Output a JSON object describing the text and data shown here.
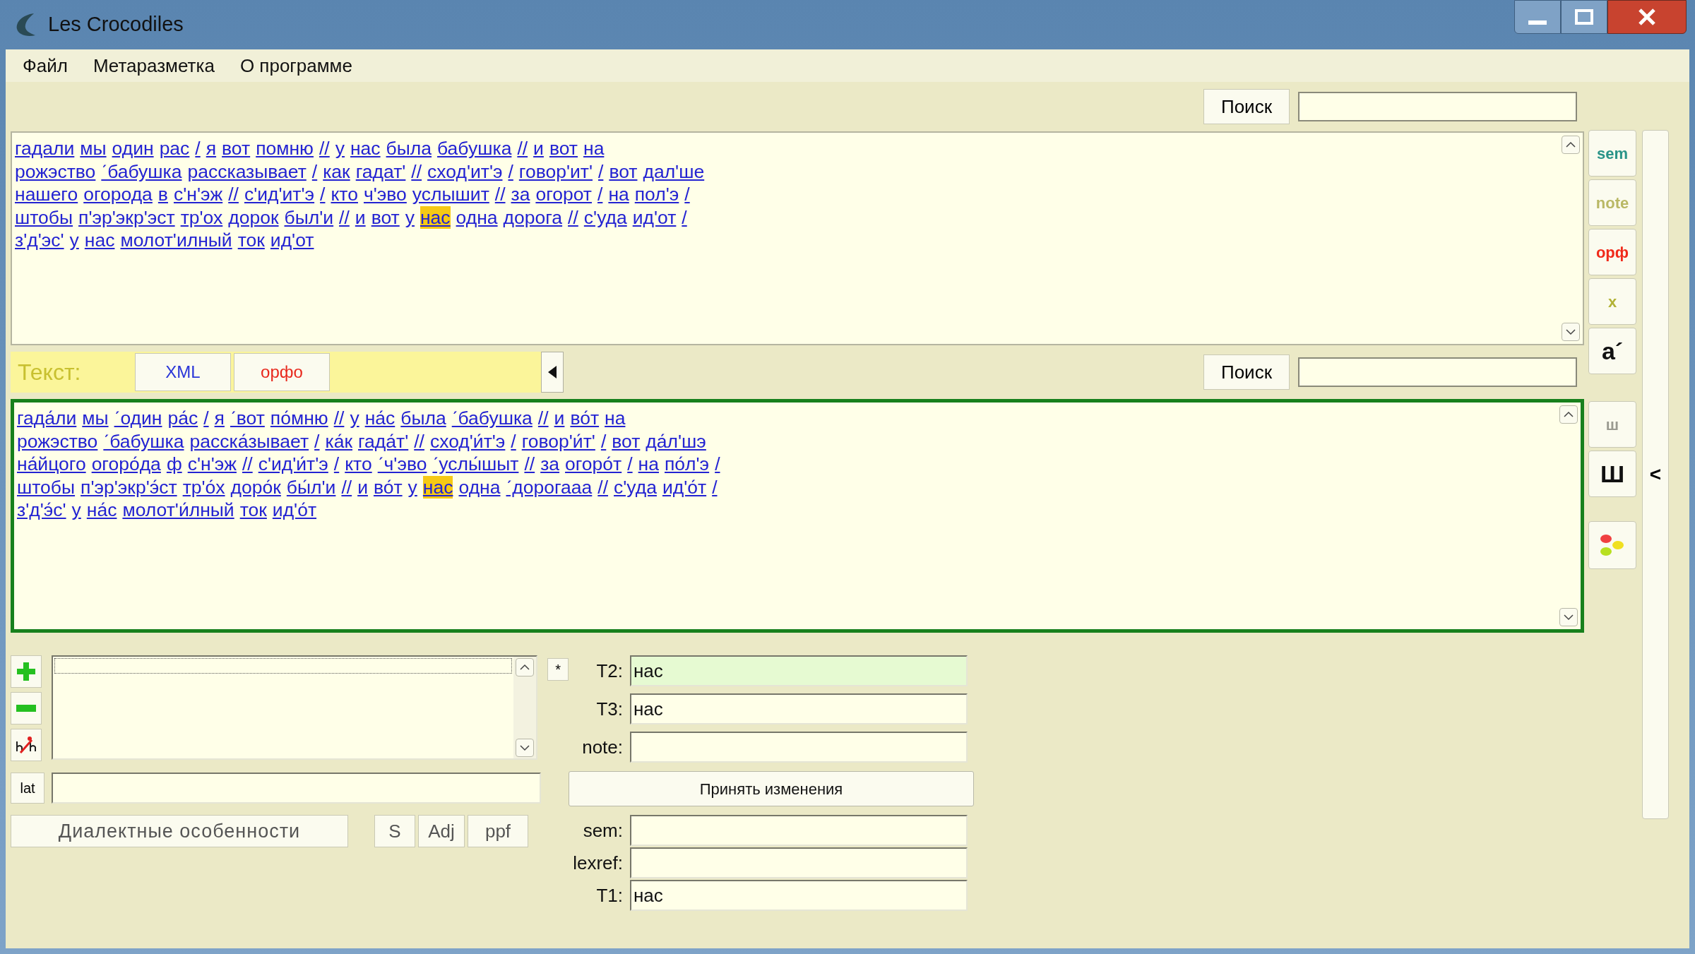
{
  "window": {
    "title": "Les Crocodiles"
  },
  "menu": [
    "Файл",
    "Метаразметка",
    "О программе"
  ],
  "top_search": {
    "button": "Поиск"
  },
  "top_text": {
    "lines": [
      [
        {
          "w": "гадали",
          "selected": false
        },
        {
          "w": "мы",
          "selected": false
        },
        {
          "w": "один",
          "selected": false
        },
        {
          "w": "рас",
          "selected": false
        },
        {
          "w": "/",
          "selected": false
        },
        {
          "w": "я",
          "selected": false
        },
        {
          "w": "вот",
          "selected": false
        },
        {
          "w": "помню",
          "selected": false
        },
        {
          "w": "//",
          "selected": false
        },
        {
          "w": "у",
          "selected": false
        },
        {
          "w": "нас",
          "selected": false
        },
        {
          "w": "была",
          "selected": false
        },
        {
          "w": "бабушка",
          "selected": false
        },
        {
          "w": "//",
          "selected": false
        },
        {
          "w": "и",
          "selected": false
        },
        {
          "w": "вот",
          "selected": false
        },
        {
          "w": "на",
          "selected": false
        }
      ],
      [
        {
          "w": "рожэство",
          "selected": false
        },
        {
          "w": "ˊбабушка",
          "selected": false
        },
        {
          "w": "рассказывает",
          "selected": false
        },
        {
          "w": "/",
          "selected": false
        },
        {
          "w": "как",
          "selected": false
        },
        {
          "w": "гадат'",
          "selected": false
        },
        {
          "w": "//",
          "selected": false
        },
        {
          "w": "сход'ит'э",
          "selected": false
        },
        {
          "w": "/",
          "selected": false
        },
        {
          "w": "говор'ит'",
          "selected": false
        },
        {
          "w": "/",
          "selected": false
        },
        {
          "w": "вот",
          "selected": false
        },
        {
          "w": "дал'ше",
          "selected": false
        }
      ],
      [
        {
          "w": "нашего",
          "selected": false
        },
        {
          "w": "огорода",
          "selected": false
        },
        {
          "w": "в",
          "selected": false
        },
        {
          "w": "с'н'эж",
          "selected": false
        },
        {
          "w": "//",
          "selected": false
        },
        {
          "w": "с'ид'ит'э",
          "selected": false
        },
        {
          "w": "/",
          "selected": false
        },
        {
          "w": "кто",
          "selected": false
        },
        {
          "w": "ч'эво",
          "selected": false
        },
        {
          "w": "услышит",
          "selected": false
        },
        {
          "w": "//",
          "selected": false
        },
        {
          "w": "за",
          "selected": false
        },
        {
          "w": "огорот",
          "selected": false
        },
        {
          "w": "/",
          "selected": false
        },
        {
          "w": "на",
          "selected": false
        },
        {
          "w": "пол'э",
          "selected": false
        },
        {
          "w": "/",
          "selected": false
        }
      ],
      [
        {
          "w": "штобы",
          "selected": false
        },
        {
          "w": "п'эр'экр'эст",
          "selected": false
        },
        {
          "w": "тр'ох",
          "selected": false
        },
        {
          "w": "дорок",
          "selected": false
        },
        {
          "w": "был'и",
          "selected": false
        },
        {
          "w": "//",
          "selected": false
        },
        {
          "w": "и",
          "selected": false
        },
        {
          "w": "вот",
          "selected": false
        },
        {
          "w": "у",
          "selected": false
        },
        {
          "w": "нас",
          "selected": true
        },
        {
          "w": "одна",
          "selected": false
        },
        {
          "w": "дорога",
          "selected": false
        },
        {
          "w": "//",
          "selected": false
        },
        {
          "w": "с'уда",
          "selected": false
        },
        {
          "w": "ид'от",
          "selected": false
        },
        {
          "w": "/",
          "selected": false
        }
      ],
      [
        {
          "w": "з'д'эс'",
          "selected": false
        },
        {
          "w": "у",
          "selected": false
        },
        {
          "w": "нас",
          "selected": false
        },
        {
          "w": "молот'илный",
          "selected": false
        },
        {
          "w": "ток",
          "selected": false
        },
        {
          "w": "ид'от",
          "selected": false
        }
      ]
    ]
  },
  "side_buttons": [
    {
      "kind": "text",
      "label": "sem",
      "color": "#2a9488"
    },
    {
      "kind": "text",
      "label": "note",
      "color": "#b9b865"
    },
    {
      "kind": "text",
      "label": "орф",
      "color": "#f02a1a"
    },
    {
      "kind": "text",
      "label": "x",
      "color": "#b2b236"
    },
    {
      "kind": "big",
      "label": "а´",
      "color": "#111111"
    }
  ],
  "side_buttons_lower": [
    {
      "kind": "text",
      "label": "ш",
      "color": "#9a9a90"
    },
    {
      "kind": "big",
      "label": "Ш",
      "color": "#111111"
    },
    {
      "kind": "lights"
    }
  ],
  "collapse_bar": {
    "label": "<"
  },
  "toolbar": {
    "label": "Текст:",
    "tabs": [
      {
        "label": "XML",
        "color": "#2a36d8"
      },
      {
        "label": "орфо",
        "color": "#e8281c"
      }
    ],
    "search_button": "Поиск"
  },
  "bottom_text": {
    "lines": [
      [
        {
          "w": "гада́ли",
          "selected": false
        },
        {
          "w": "мы",
          "selected": false
        },
        {
          "w": "ˊодин",
          "selected": false
        },
        {
          "w": "ра́с",
          "selected": false
        },
        {
          "w": "/",
          "selected": false
        },
        {
          "w": "я",
          "selected": false
        },
        {
          "w": "ˊвот",
          "selected": false
        },
        {
          "w": "по́мню",
          "selected": false
        },
        {
          "w": "//",
          "selected": false
        },
        {
          "w": "у",
          "selected": false
        },
        {
          "w": "на́с",
          "selected": false
        },
        {
          "w": "была",
          "selected": false
        },
        {
          "w": "ˊбабушка",
          "selected": false
        },
        {
          "w": "//",
          "selected": false
        },
        {
          "w": "и",
          "selected": false
        },
        {
          "w": "во́т",
          "selected": false
        },
        {
          "w": "на",
          "selected": false
        }
      ],
      [
        {
          "w": "рожэство",
          "selected": false
        },
        {
          "w": "ˊбабушка",
          "selected": false
        },
        {
          "w": "расска́зывает",
          "selected": false
        },
        {
          "w": "/",
          "selected": false
        },
        {
          "w": "ка́к",
          "selected": false
        },
        {
          "w": "гада́т'",
          "selected": false
        },
        {
          "w": "//",
          "selected": false
        },
        {
          "w": "сход'и́т'э",
          "selected": false
        },
        {
          "w": "/",
          "selected": false
        },
        {
          "w": "говор'и́т'",
          "selected": false
        },
        {
          "w": "/",
          "selected": false
        },
        {
          "w": "вот",
          "selected": false
        },
        {
          "w": "да́л'шэ",
          "selected": false
        }
      ],
      [
        {
          "w": "на́йцого",
          "selected": false
        },
        {
          "w": "огоро́да",
          "selected": false
        },
        {
          "w": "ф",
          "selected": false
        },
        {
          "w": "с'н'эж",
          "selected": false
        },
        {
          "w": "//",
          "selected": false
        },
        {
          "w": "с'ид'и́т'э",
          "selected": false
        },
        {
          "w": "/",
          "selected": false
        },
        {
          "w": "кто",
          "selected": false
        },
        {
          "w": "ˊч'эво",
          "selected": false
        },
        {
          "w": "ˊуслы́шыт",
          "selected": false
        },
        {
          "w": "//",
          "selected": false
        },
        {
          "w": "за",
          "selected": false
        },
        {
          "w": "огоро́т",
          "selected": false
        },
        {
          "w": "/",
          "selected": false
        },
        {
          "w": "на",
          "selected": false
        },
        {
          "w": "по́л'э",
          "selected": false
        },
        {
          "w": "/",
          "selected": false
        }
      ],
      [
        {
          "w": "штобы",
          "selected": false
        },
        {
          "w": "п'эр'экр'э́ст",
          "selected": false
        },
        {
          "w": "тр'о́х",
          "selected": false
        },
        {
          "w": "доро́к",
          "selected": false
        },
        {
          "w": "бы́л'и",
          "selected": false
        },
        {
          "w": "//",
          "selected": false
        },
        {
          "w": "и",
          "selected": false
        },
        {
          "w": "во́т",
          "selected": false
        },
        {
          "w": "у",
          "selected": false
        },
        {
          "w": "нас",
          "selected": true
        },
        {
          "w": "одна",
          "selected": false
        },
        {
          "w": "ˊдорогааа",
          "selected": false
        },
        {
          "w": "//",
          "selected": false
        },
        {
          "w": "с'уда",
          "selected": false
        },
        {
          "w": "ид'о́т",
          "selected": false
        },
        {
          "w": "/",
          "selected": false
        }
      ],
      [
        {
          "w": "з'д'э́с'",
          "selected": false
        },
        {
          "w": "у",
          "selected": false
        },
        {
          "w": "на́с",
          "selected": false
        },
        {
          "w": "молот'и́лный",
          "selected": false
        },
        {
          "w": "ток",
          "selected": false
        },
        {
          "w": "ид'о́т",
          "selected": false
        }
      ]
    ]
  },
  "edit_panel": {
    "star_button": "*",
    "lat_button": "lat",
    "dialect_button": "Диалектные особенности",
    "tags": [
      "S",
      "Adj",
      "ppf"
    ],
    "accept_button": "Принять изменения",
    "fields_top": [
      {
        "label": "T2:",
        "value": "нас",
        "selected": true
      },
      {
        "label": "T3:",
        "value": "нас",
        "selected": false
      },
      {
        "label": "note:",
        "selected": false
      }
    ],
    "fields_bottom": [
      {
        "label": "sem:",
        "selected": false
      },
      {
        "label": "lexref:",
        "selected": false
      },
      {
        "label": "T1:",
        "value": "нас",
        "selected": false
      }
    ]
  }
}
